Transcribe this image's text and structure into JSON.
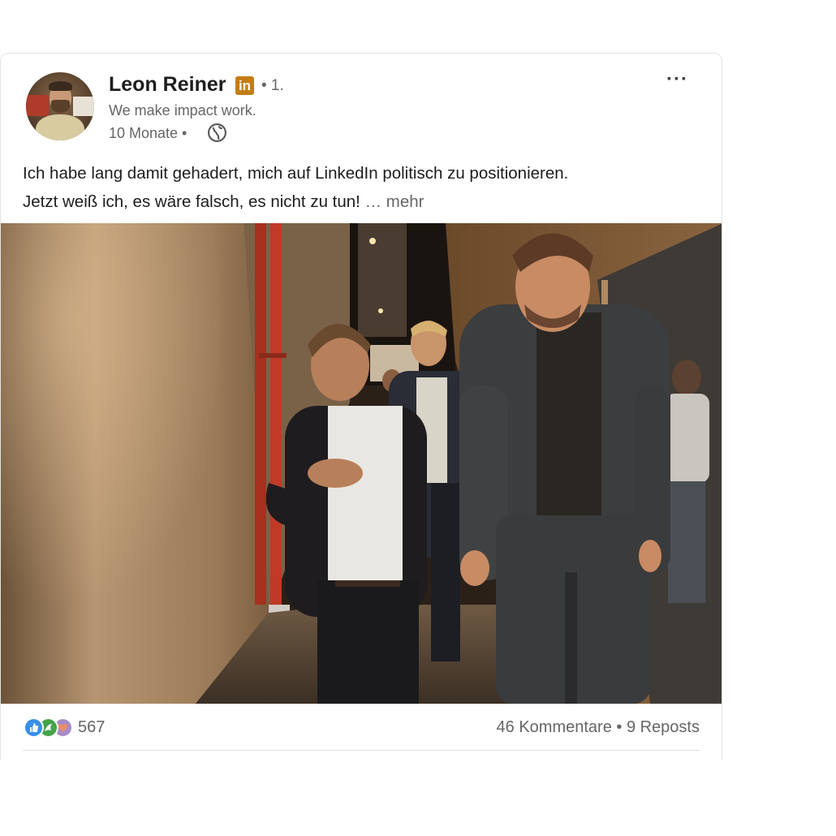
{
  "post": {
    "author": {
      "name": "Leon Reiner",
      "badge": "in",
      "connection": "• 1.",
      "headline": "We make impact work.",
      "time": "10 Monate •",
      "visibility_icon": "globe-icon"
    },
    "menu_label": "···",
    "text_line1": "Ich habe lang damit gehadert, mich auf LinkedIn politisch zu positionieren.",
    "text_line2": "Jetzt weiß ich, es wäre falsch, es nicht zu tun!",
    "see_more": "… mehr",
    "social": {
      "reaction_icons": [
        "like-icon",
        "celebrate-icon",
        "love-icon"
      ],
      "reaction_count": "567",
      "comments": "46 Kommentare",
      "separator": " • ",
      "reposts": "9 Reposts"
    }
  },
  "colors": {
    "badge": "#c37d16",
    "text_primary": "#1d1d1d",
    "text_secondary": "#666666",
    "like": "#378fe9",
    "celebrate": "#44a34b",
    "love": "#a78bc6"
  }
}
